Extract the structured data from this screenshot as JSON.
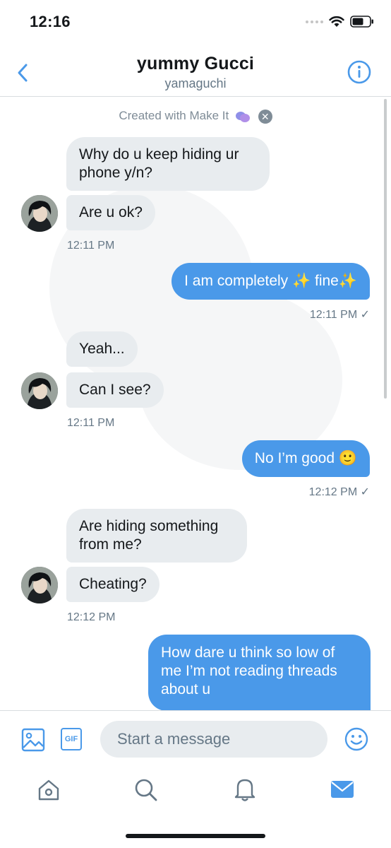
{
  "status_bar": {
    "time": "12:16"
  },
  "header": {
    "title": "yummy Gucci",
    "subtitle": "yamaguchi"
  },
  "banner": {
    "text": "Created with Make It"
  },
  "messages": [
    {
      "text": "Why do u keep hiding ur phone y/n?",
      "dir": "in"
    },
    {
      "text": "Are u ok?",
      "dir": "in"
    },
    {
      "text": "12:11 PM",
      "kind": "timestamp"
    },
    {
      "text": "I am completely ✨ fine✨",
      "dir": "out"
    },
    {
      "text": "12:11 PM ✓",
      "kind": "timestamp"
    },
    {
      "text": "Yeah...",
      "dir": "in"
    },
    {
      "text": "Can I see?",
      "dir": "in"
    },
    {
      "text": "12:11 PM",
      "kind": "timestamp"
    },
    {
      "text": "No I’m good 🙂",
      "dir": "out"
    },
    {
      "text": "12:12 PM ✓",
      "kind": "timestamp"
    },
    {
      "text": "Are hiding something from me?",
      "dir": "in"
    },
    {
      "text": "Cheating?",
      "dir": "in"
    },
    {
      "text": "12:12 PM",
      "kind": "timestamp"
    },
    {
      "text": "How dare u think so low of me I’m not reading threads about u",
      "dir": "out"
    }
  ],
  "composer": {
    "placeholder": "Start a message",
    "gif_label": "GIF"
  },
  "colors": {
    "accent": "#4a99e9",
    "bubble_in": "#e8ecef",
    "muted": "#657786"
  },
  "icons": {
    "back": "chevron-left-icon",
    "info": "info-icon",
    "image": "image-icon",
    "gif": "gif-icon",
    "emoji": "emoji-icon",
    "home": "home-icon",
    "search": "search-icon",
    "notifications": "bell-icon",
    "messages": "mail-icon"
  }
}
